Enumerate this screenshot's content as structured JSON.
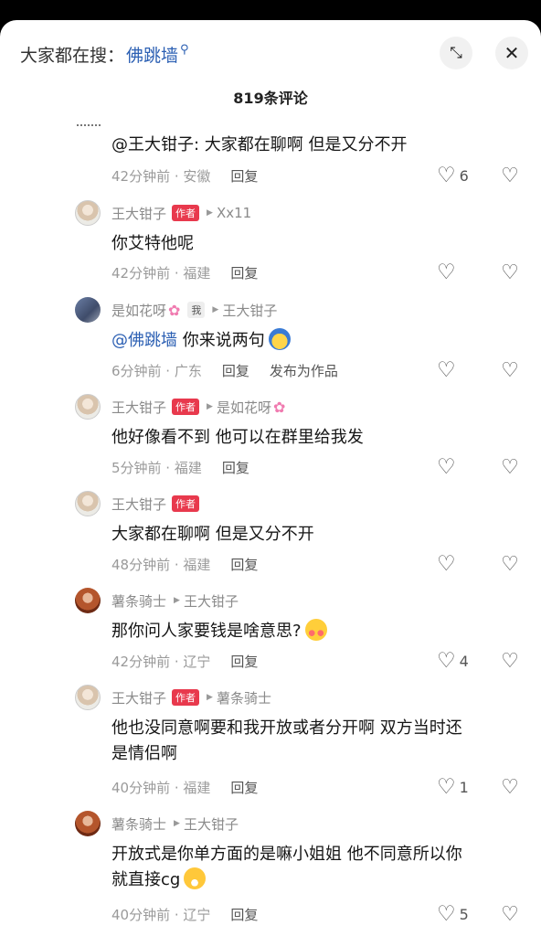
{
  "search": {
    "prefix": "大家都在搜：",
    "keyword": "佛跳墙",
    "search_icon": "search-icon"
  },
  "header": {
    "comment_count": "819条评论",
    "collapse_icon": "collapse-icon",
    "close_icon": "close-icon"
  },
  "comments": [
    {
      "text": "@王大钳子: 大家都在聊啊 但是又分不开",
      "time_loc": "42分钟前 · 安徽",
      "reply": "回复",
      "likes": "6"
    },
    {
      "name": "王大钳子",
      "tag": "作者",
      "to": "Xx11",
      "text": "你艾特他呢",
      "time_loc": "42分钟前 · 福建",
      "reply": "回复",
      "likes": ""
    },
    {
      "name": "是如花呀",
      "tag": "我",
      "to": "王大钳子",
      "mention": "@佛跳墙",
      "text": " 你来说两句",
      "time_loc": "6分钟前 · 广东",
      "reply": "回复",
      "publish": "发布为作品",
      "likes": ""
    },
    {
      "name": "王大钳子",
      "tag": "作者",
      "to": "是如花呀",
      "text": "他好像看不到 他可以在群里给我发",
      "time_loc": "5分钟前 · 福建",
      "reply": "回复",
      "likes": ""
    },
    {
      "name": "王大钳子",
      "tag": "作者",
      "text": "大家都在聊啊 但是又分不开",
      "time_loc": "48分钟前 · 福建",
      "reply": "回复",
      "likes": ""
    },
    {
      "name": "薯条骑士",
      "to": "王大钳子",
      "text": "那你问人家要钱是啥意思?",
      "time_loc": "42分钟前 · 辽宁",
      "reply": "回复",
      "likes": "4"
    },
    {
      "name": "王大钳子",
      "tag": "作者",
      "to": "薯条骑士",
      "text_l1": "他也没同意啊要和我开放或者分开啊 双方当时还",
      "text_l2": "是情侣啊",
      "time_loc": "40分钟前 · 福建",
      "reply": "回复",
      "likes": "1"
    },
    {
      "name": "薯条骑士",
      "to": "王大钳子",
      "text_l1": "开放式是你单方面的是嘛小姐姐 他不同意所以你",
      "text_l2": "就直接cg",
      "time_loc": "40分钟前 · 辽宁",
      "reply": "回复",
      "likes": "5"
    }
  ],
  "colors": {
    "accent_link": "#2b5fb3",
    "author_tag": "#e8394d",
    "meta_gray": "#8a8a8a"
  }
}
